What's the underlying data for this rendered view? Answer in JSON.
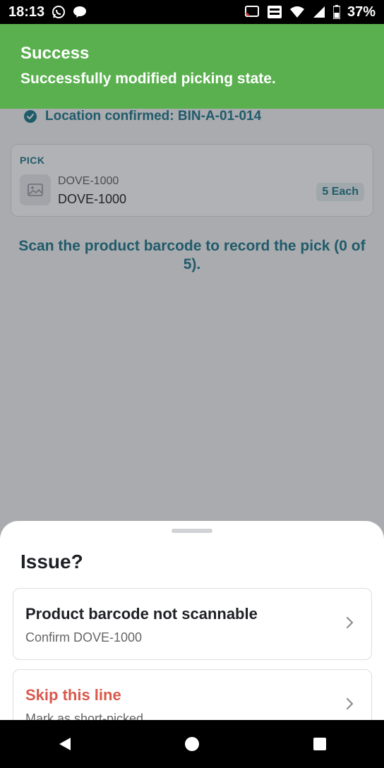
{
  "status_bar": {
    "time": "18:13",
    "battery_percent": "37%",
    "icons": [
      "whatsapp-icon",
      "chat-icon",
      "cast-icon",
      "vowifi-icon",
      "wifi-icon",
      "signal-icon",
      "battery-icon"
    ]
  },
  "toast": {
    "title": "Success",
    "message": "Successfully modified picking state.",
    "color": "#5ab04f"
  },
  "location": {
    "text": "Location confirmed: BIN-A-01-014"
  },
  "pick": {
    "label": "PICK",
    "sku_small": "DOVE-1000",
    "sku_main": "DOVE-1000",
    "qty": "5 Each"
  },
  "scan_message": "Scan the product barcode to record the pick (0 of 5).",
  "sheet": {
    "heading": "Issue?",
    "options": [
      {
        "title": "Product barcode not scannable",
        "subtitle": "Confirm DOVE-1000"
      },
      {
        "title": "Skip this line",
        "subtitle": "Mark as short-picked"
      }
    ]
  },
  "colors": {
    "accent": "#0f6f82",
    "danger": "#d9584b"
  }
}
